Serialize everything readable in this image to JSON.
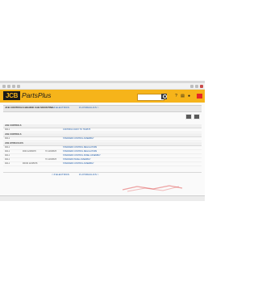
{
  "app": {
    "brand": "JCB",
    "product": "PartsPlus",
    "brand_color": "#f6b41a",
    "search_placeholder": ""
  },
  "section": {
    "title": "JCB CONTROLS BEHIND CAB MOUNTING",
    "prev_link": "< # ELECTRICS",
    "next_link": "# HYDRAULICS >"
  },
  "groups": [
    {
      "title": "JCB CONTROLS",
      "rows": [
        {
          "ref": "004-1",
          "part": "",
          "qty": "",
          "desc": "CONTROLS ASSY TO 7632575"
        }
      ]
    },
    {
      "title": "JCB CONTROLS",
      "rows": [
        {
          "ref": "004-1",
          "part": "",
          "qty": "",
          "desc": "STANDARD CONTROL ASSEMBLY"
        }
      ]
    },
    {
      "title": "JCB HYDRAULICS",
      "rows": [
        {
          "ref": "004-1",
          "part": "",
          "qty": "",
          "desc": "STANDARD CONTROL REGULATORS"
        },
        {
          "ref": "004-1",
          "part": "ROD 12345678",
          "qty": "70 12345678",
          "desc": "STANDARD CONTROL REGULATORS"
        },
        {
          "ref": "004-1",
          "part": "",
          "qty": "",
          "desc": "STANDARD CONTROL PANEL ASSEMBLY"
        },
        {
          "ref": "004-1",
          "part": "",
          "qty": "70 12345678",
          "desc": "STANDARD PANEL ASSEMBLY"
        },
        {
          "ref": "004-1",
          "part": "FROM 12345678",
          "qty": "",
          "desc": "STANDARD CONTROL ASSEMBLY"
        }
      ]
    }
  ],
  "footer": {
    "prev_link": "< # ELECTRICS",
    "next_link": "# HYDRAULICS >"
  },
  "icons": {
    "toolbar": [
      "back-icon",
      "forward-icon",
      "home-icon",
      "print-icon"
    ],
    "header": [
      "search-icon",
      "help-icon",
      "print-icon",
      "user-icon",
      "cart-icon"
    ],
    "grid": [
      "list-view-icon",
      "grid-view-icon"
    ]
  }
}
